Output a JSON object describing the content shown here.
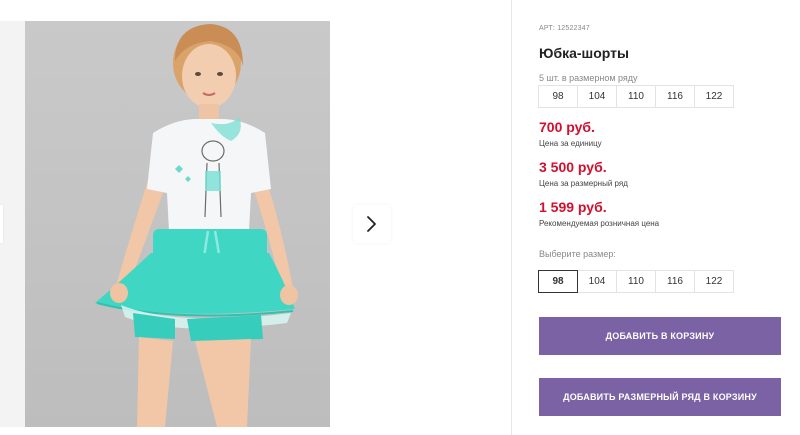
{
  "product": {
    "article": "АРТ: 12522347",
    "title": "Юбка-шорты",
    "pack_note": "5 шт. в размерном ряду",
    "pack_sizes": [
      "98",
      "104",
      "110",
      "116",
      "122"
    ]
  },
  "prices": [
    {
      "value": "700 руб.",
      "label": "Цена за единицу"
    },
    {
      "value": "3 500 руб.",
      "label": "Цена за размерный ряд"
    },
    {
      "value": "1 599 руб.",
      "label": "Рекомендуемая розничная цена"
    }
  ],
  "size_select": {
    "label": "Выберите размер:",
    "options": [
      "98",
      "104",
      "110",
      "116",
      "122"
    ],
    "selected": "98"
  },
  "actions": {
    "add_to_cart": "ДОБАВИТЬ В КОРЗИНУ",
    "add_pack_to_cart": "ДОБАВИТЬ РАЗМЕРНЫЙ РЯД В КОРЗИНУ"
  },
  "colors": {
    "accent_button": "#7a62a5",
    "price_red": "#d0102d",
    "skirt_mint": "#3fd6c4"
  },
  "gallery": {
    "next_icon": "chevron-right-icon"
  }
}
